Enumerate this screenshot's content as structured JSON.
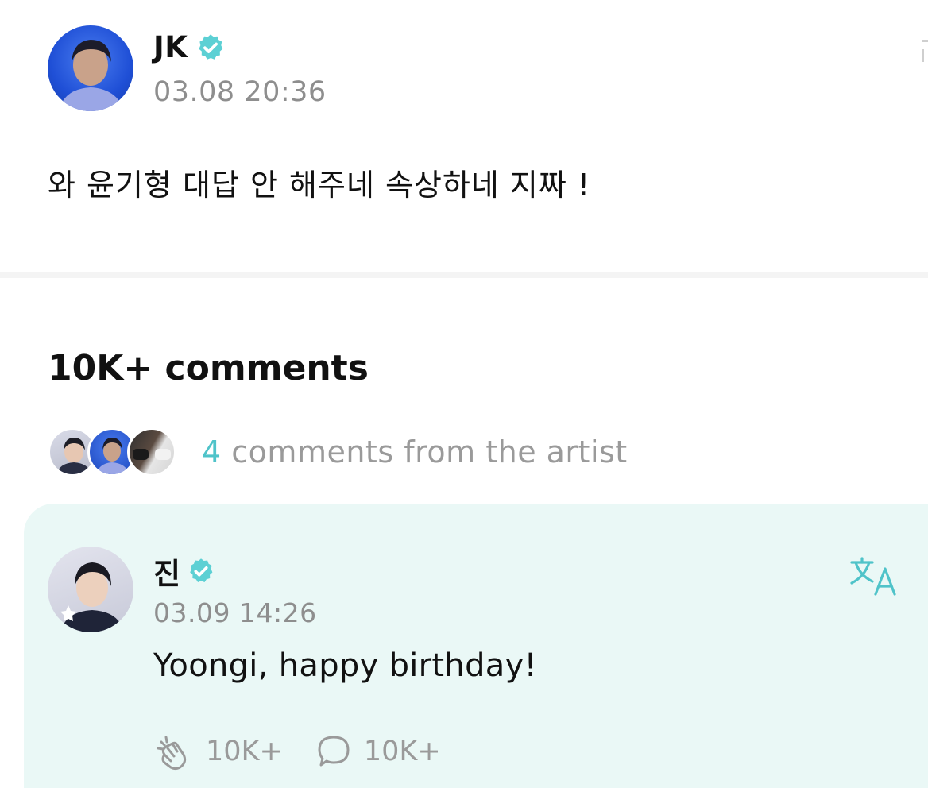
{
  "post": {
    "author": "JK",
    "verified_icon": "verified-badge-icon",
    "timestamp": "03.08 20:36",
    "body": "와 윤기형 대답 안 해주네 속상하네 지짜 !"
  },
  "comments": {
    "count_label": "10K+ comments",
    "artist_comments_count": "4",
    "artist_comments_label": "comments from the artist"
  },
  "highlighted_comment": {
    "author": "진",
    "timestamp": "03.09 14:26",
    "body": "Yoongi, happy birthday!",
    "likes": "10K+",
    "replies": "10K+"
  },
  "colors": {
    "accent": "#4fc3c9",
    "card_background": "#eaf8f6",
    "muted_text": "#8e8e8e"
  }
}
